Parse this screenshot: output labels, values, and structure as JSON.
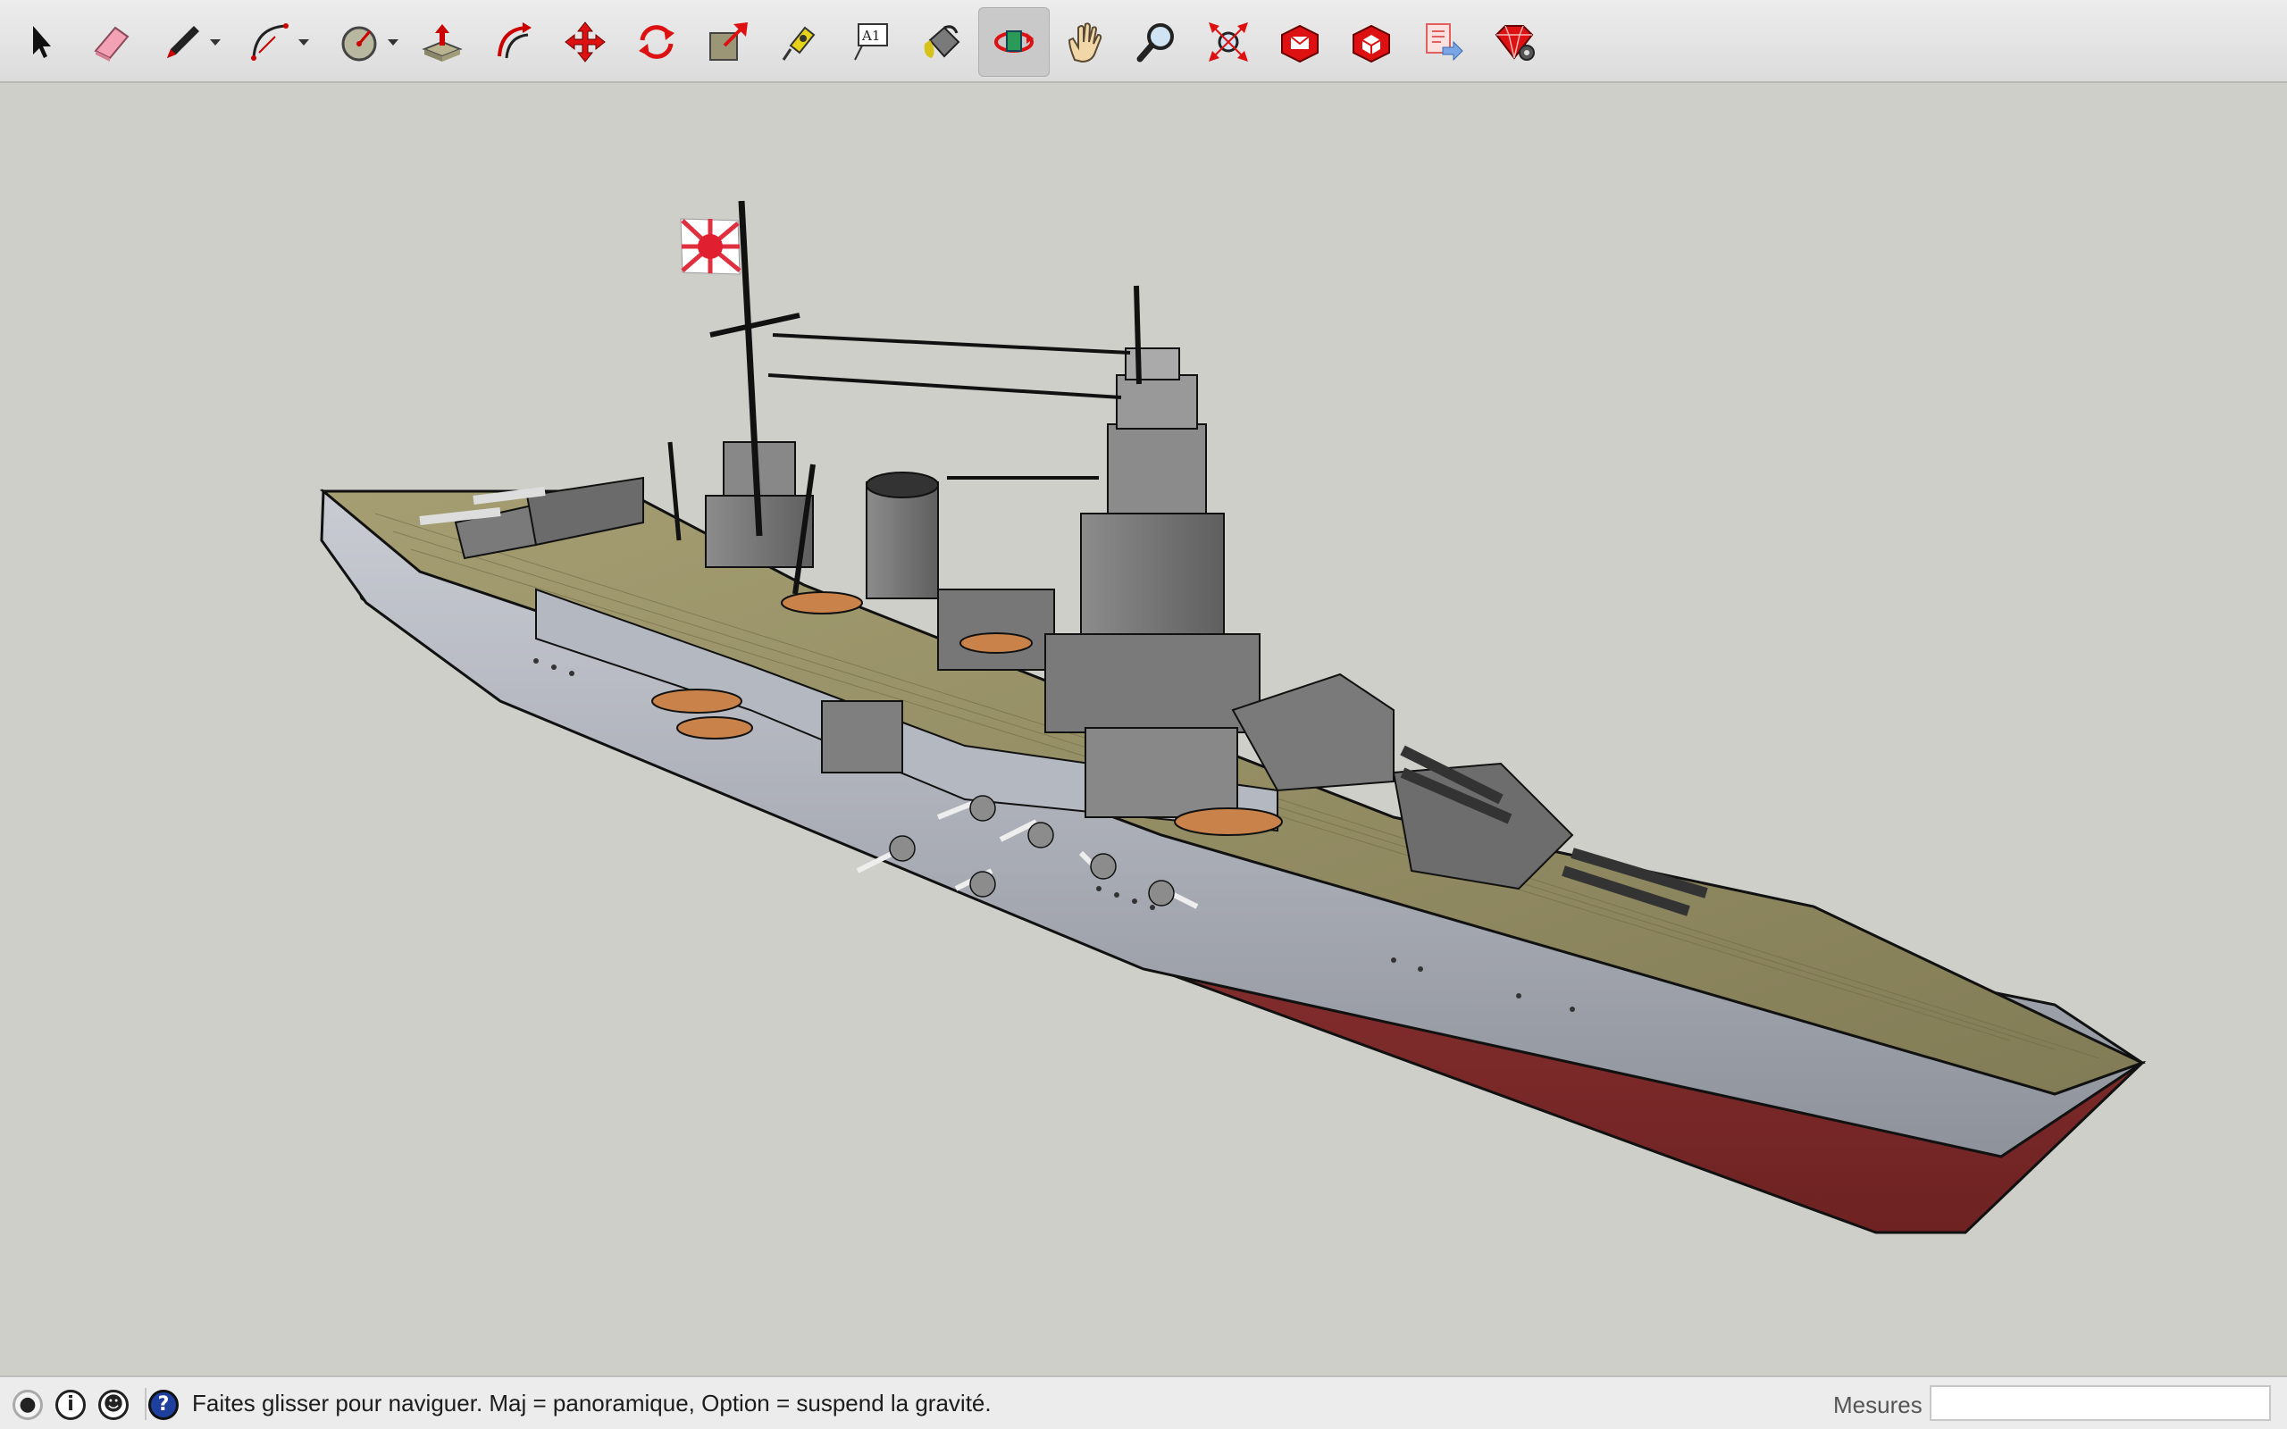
{
  "toolbar": {
    "tools": [
      {
        "name": "select-tool",
        "icon": "arrow-icon"
      },
      {
        "name": "eraser-tool",
        "icon": "eraser-icon"
      },
      {
        "name": "line-tool",
        "icon": "pencil-icon",
        "dropdown": true
      },
      {
        "name": "arc-tool",
        "icon": "arc-icon",
        "dropdown": true
      },
      {
        "name": "shapes-tool",
        "icon": "circle-icon",
        "dropdown": true
      },
      {
        "name": "push-pull-tool",
        "icon": "push-pull-icon"
      },
      {
        "name": "offset-tool",
        "icon": "offset-icon"
      },
      {
        "name": "move-tool",
        "icon": "move-arrows-icon"
      },
      {
        "name": "rotate-tool",
        "icon": "rotate-icon"
      },
      {
        "name": "scale-tool",
        "icon": "scale-icon"
      },
      {
        "name": "tape-measure-tool",
        "icon": "tape-measure-icon"
      },
      {
        "name": "text-tool",
        "icon": "text-label-icon",
        "label": "A1"
      },
      {
        "name": "paint-bucket-tool",
        "icon": "paint-bucket-icon"
      },
      {
        "name": "orbit-tool",
        "icon": "orbit-icon",
        "active": true
      },
      {
        "name": "pan-tool",
        "icon": "hand-icon"
      },
      {
        "name": "zoom-tool",
        "icon": "magnifier-icon"
      },
      {
        "name": "zoom-extents-tool",
        "icon": "zoom-extents-icon"
      },
      {
        "name": "warehouse-tool",
        "icon": "3d-warehouse-icon"
      },
      {
        "name": "extension-warehouse-tool",
        "icon": "extension-warehouse-icon"
      },
      {
        "name": "send-to-layout-tool",
        "icon": "send-to-layout-icon"
      },
      {
        "name": "extension-manager-tool",
        "icon": "ruby-gem-icon"
      }
    ]
  },
  "viewport": {
    "model": "battleship-3d-model",
    "background_color": "#cfcfca"
  },
  "statusbar": {
    "hint_text": "Faites glisser pour naviguer. Maj = panoramique, Option =  suspend la gravité.",
    "measure_label": "Mesures",
    "measure_value": ""
  }
}
